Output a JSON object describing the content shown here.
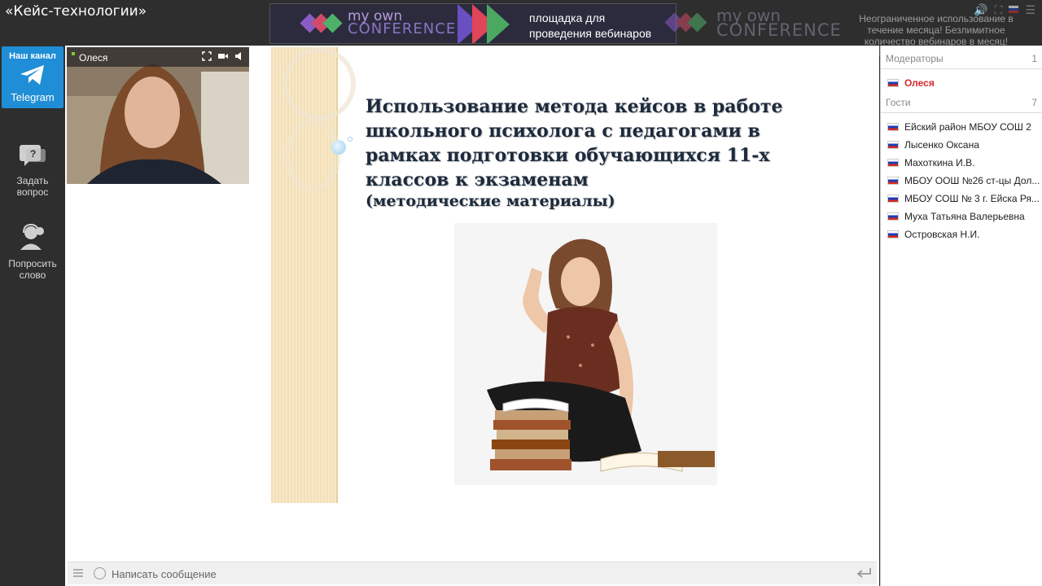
{
  "app": {
    "title": "«Кейс-технологии»"
  },
  "banner": {
    "logo_line1": "my own",
    "logo_line2": "CONFERENCE",
    "text_line1": "площадка для",
    "text_line2": "проведения вебинаров"
  },
  "logo_right": {
    "line1": "my own",
    "line2": "CONFERENCE"
  },
  "promo": {
    "text": "Неограниченное использование в течение месяца! Безлимитное количество вебинаров в месяц!"
  },
  "sidebar": {
    "telegram": {
      "caption": "Наш канал",
      "label": "Telegram"
    },
    "items": [
      {
        "label_1": "Задать",
        "label_2": "вопрос"
      },
      {
        "label_1": "Попросить",
        "label_2": "слово"
      }
    ]
  },
  "video": {
    "name": "Олеся"
  },
  "slide": {
    "title": "Использование метода кейсов в работе школьного психолога с педагогами в рамках подготовки обучающихся 11-х классов к экзаменам",
    "subtitle": "(методические материалы)"
  },
  "chat": {
    "placeholder": "Написать сообщение"
  },
  "participants": {
    "moderators_label": "Модераторы",
    "moderators_count": "1",
    "moderators": [
      "Олеся"
    ],
    "guests_label": "Гости",
    "guests_count": "7",
    "guests": [
      "Ейский район МБОУ СОШ 2",
      "Лысенко Оксана",
      "Махоткина И.В.",
      "МБОУ ООШ №26 ст-цы Дол...",
      "МБОУ СОШ № 3 г. Ейска Ря...",
      "Муха Татьяна Валерьевна",
      "Островская Н.И."
    ]
  },
  "colors": {
    "accent": "#1f8ed6",
    "moderator": "#d6282b",
    "background": "#2e2e2e"
  }
}
